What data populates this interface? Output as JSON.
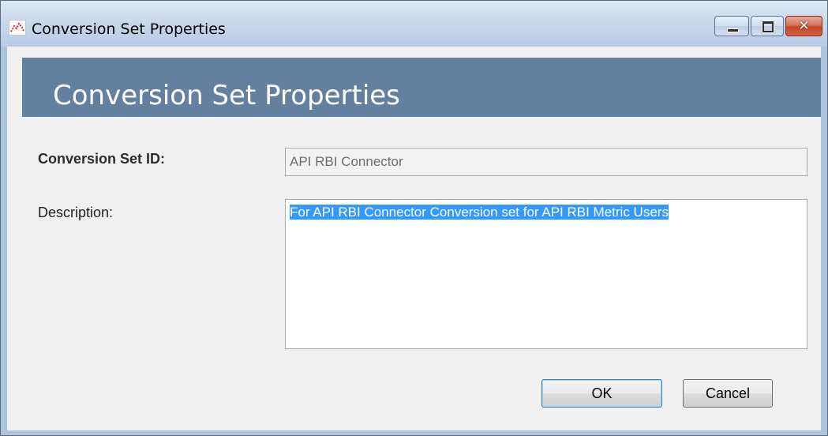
{
  "window": {
    "title": "Conversion Set Properties",
    "icon": "chart-app-icon",
    "controls": {
      "minimize": "minimize-icon",
      "maximize": "maximize-icon",
      "close": "close-icon",
      "close_glyph": "✕"
    }
  },
  "header": {
    "title": "Conversion Set Properties",
    "band_color": "#63809f"
  },
  "form": {
    "id_label": "Conversion Set ID:",
    "id_value": "API RBI Connector",
    "description_label": "Description:",
    "description_value": "For API RBI Connector Conversion set for API RBI Metric Users",
    "description_selected": true
  },
  "buttons": {
    "ok_label": "OK",
    "cancel_label": "Cancel"
  },
  "colors": {
    "selection": "#3399ff",
    "close_button": "#c4442a"
  }
}
